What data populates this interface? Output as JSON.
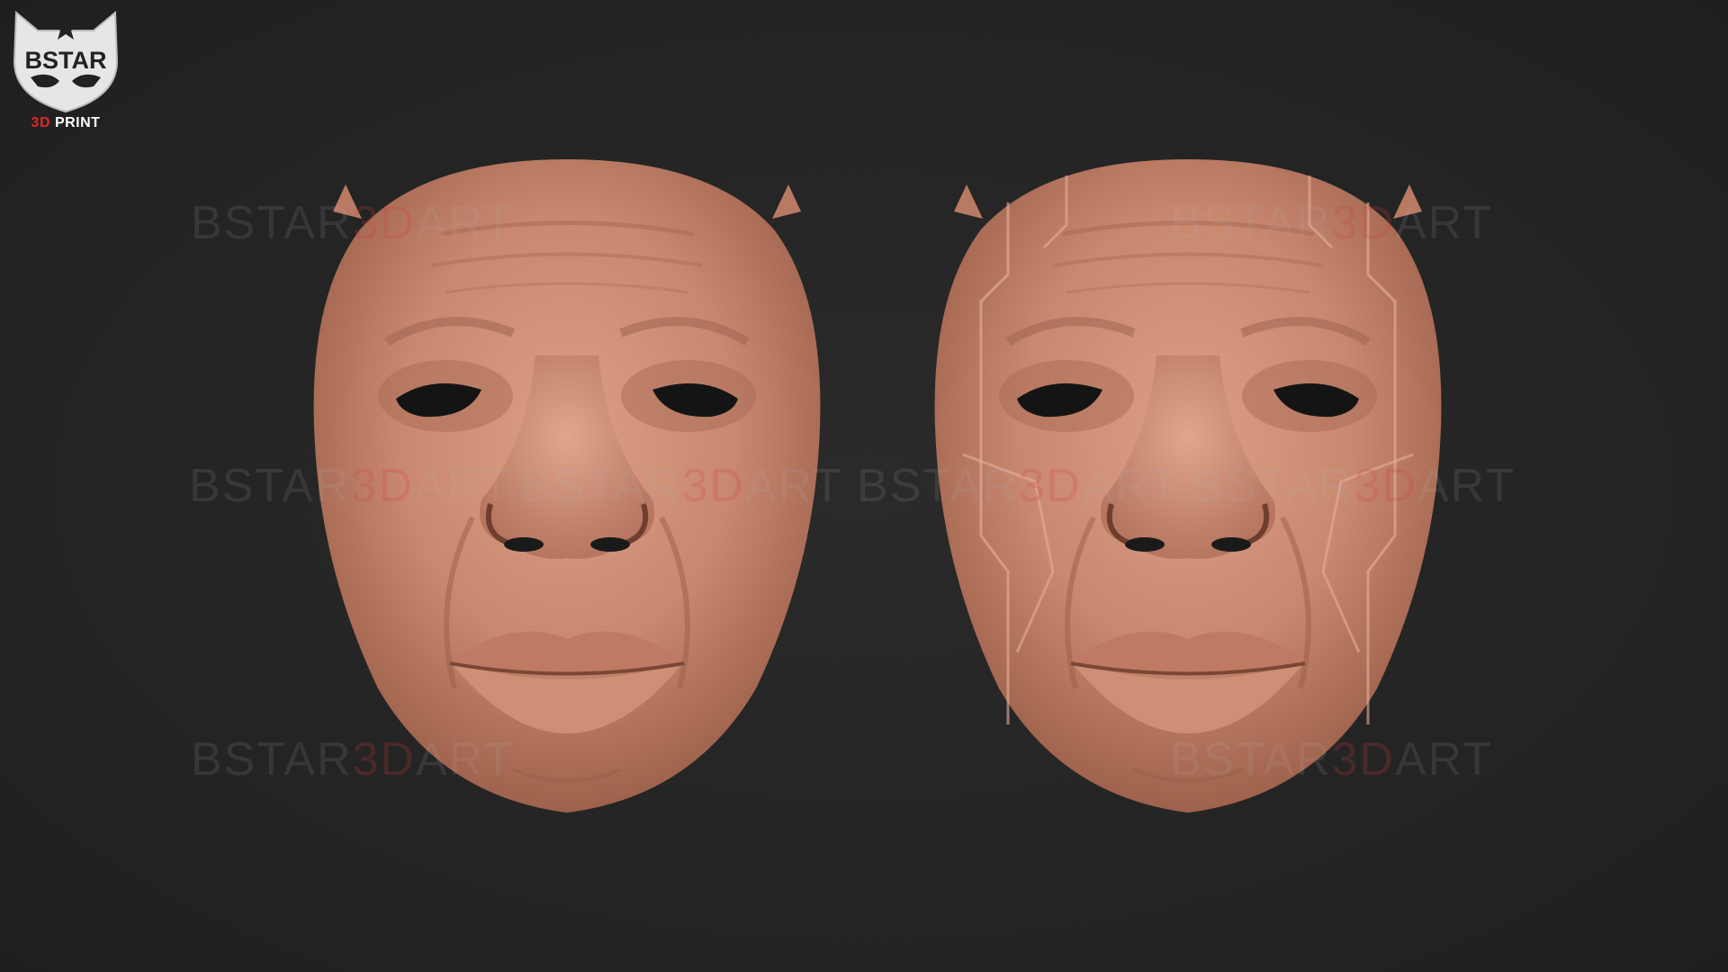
{
  "logo": {
    "brand": "BSTAR",
    "sub_prefix": "3D",
    "sub_suffix": " PRINT",
    "colors": {
      "shield": "#e8e8e8",
      "accent": "#e0262b"
    }
  },
  "watermark": {
    "prefix": "BSTAR",
    "accent": "3D",
    "suffix": "ART"
  },
  "masks": [
    {
      "name": "plain-face-mask",
      "style": "smooth skin"
    },
    {
      "name": "panel-line-face-mask",
      "style": "skin with panel lines"
    }
  ],
  "colors": {
    "background": "#242424",
    "skin": "#c98870",
    "skin_shadow": "#8c5641"
  }
}
